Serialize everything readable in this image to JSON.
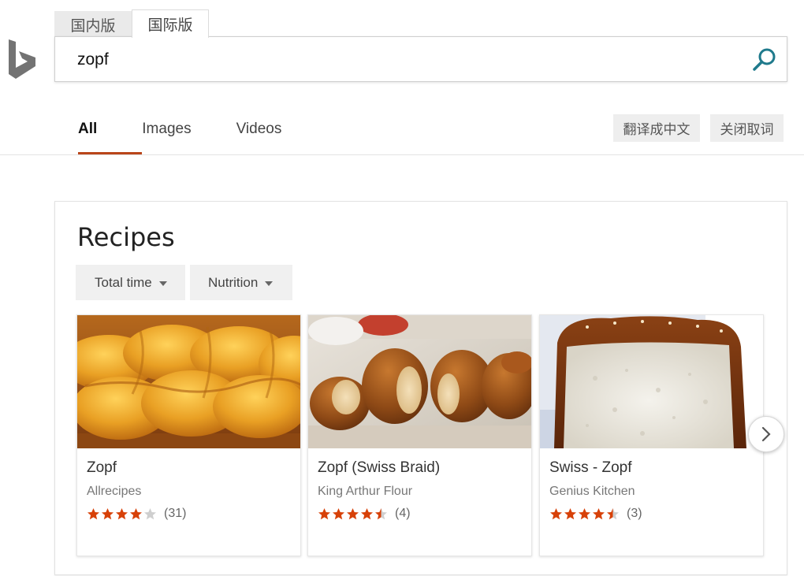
{
  "search": {
    "tabs": [
      {
        "label": "国内版"
      },
      {
        "label": "国际版"
      }
    ],
    "query": "zopf"
  },
  "nav": {
    "items": [
      {
        "label": "All"
      },
      {
        "label": "Images"
      },
      {
        "label": "Videos"
      }
    ],
    "translate_label": "翻译成中文",
    "close_label": "关闭取词"
  },
  "recipes": {
    "title": "Recipes",
    "filters": [
      {
        "label": "Total time"
      },
      {
        "label": "Nutrition"
      }
    ],
    "cards": [
      {
        "title": "Zopf",
        "source": "Allrecipes",
        "rating": 4.0,
        "count": "(31)",
        "image": "braided-bread-photo"
      },
      {
        "title": "Zopf (Swiss Braid)",
        "source": "King Arthur Flour",
        "rating": 4.5,
        "count": "(4)",
        "image": "sliced-braided-bread-photo"
      },
      {
        "title": "Swiss - Zopf",
        "source": "Genius Kitchen",
        "rating": 4.5,
        "count": "(3)",
        "image": "bread-loaf-cross-section-photo"
      }
    ]
  },
  "icons": {
    "logo": "bing-logo-icon",
    "search": "search-icon",
    "next": "chevron-right-icon",
    "star": "star-icon"
  },
  "colors": {
    "accent": "#b9451a",
    "star": "#d74108",
    "star_empty": "#cfcfcf",
    "search_icon": "#1f7a8c"
  }
}
